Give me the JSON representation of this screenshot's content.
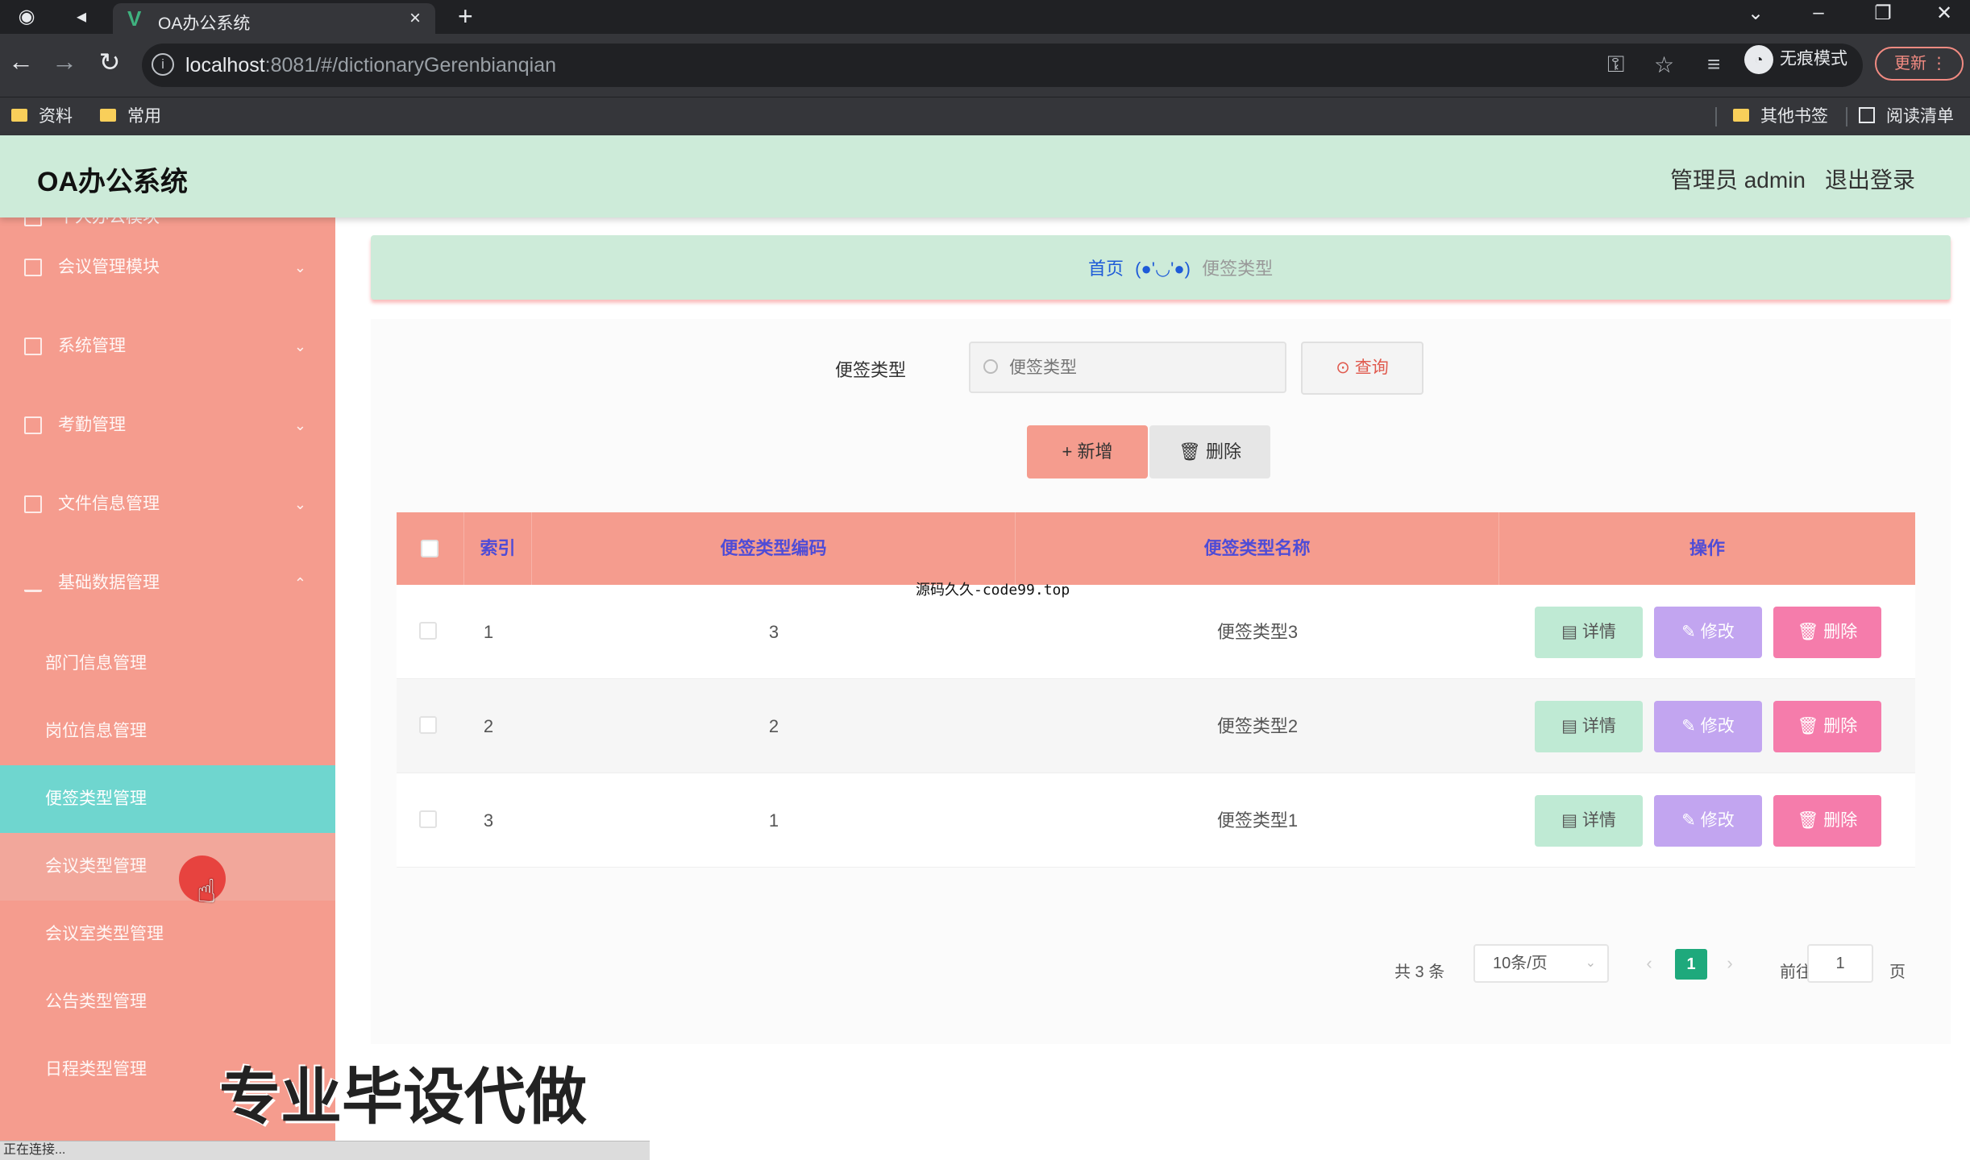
{
  "browser": {
    "tab_title": "OA办公系统",
    "tab_close": "×",
    "new_tab": "+",
    "url_host": "localhost",
    "url_rest": ":8081/#/dictionaryGerenbianqian",
    "incognito_label": "无痕模式",
    "update_label": "更新",
    "bookmarks": [
      "资料",
      "常用"
    ],
    "other_bookmarks": "其他书签",
    "reading_list": "阅读清单"
  },
  "app": {
    "title": "OA办公系统",
    "user": "管理员 admin",
    "logout": "退出登录"
  },
  "sidebar": {
    "items": [
      {
        "label": "个人办公模块"
      },
      {
        "label": "会议管理模块"
      },
      {
        "label": "系统管理"
      },
      {
        "label": "考勤管理"
      },
      {
        "label": "文件信息管理"
      },
      {
        "label": "基础数据管理"
      }
    ],
    "sub_items": [
      {
        "label": "部门信息管理"
      },
      {
        "label": "岗位信息管理"
      },
      {
        "label": "便签类型管理"
      },
      {
        "label": "会议类型管理"
      },
      {
        "label": "会议室类型管理"
      },
      {
        "label": "公告类型管理"
      },
      {
        "label": "日程类型管理"
      }
    ]
  },
  "breadcrumb": {
    "home": "首页",
    "face": "(●'◡'●)",
    "current": "便签类型"
  },
  "search": {
    "label": "便签类型",
    "placeholder": "便签类型",
    "button": "查询"
  },
  "actions": {
    "add": "+ 新增",
    "delete": "删除"
  },
  "table": {
    "headers": [
      "索引",
      "便签类型编码",
      "便签类型名称",
      "操作"
    ],
    "rows": [
      {
        "index": "1",
        "code": "3",
        "name": "便签类型3"
      },
      {
        "index": "2",
        "code": "2",
        "name": "便签类型2"
      },
      {
        "index": "3",
        "code": "1",
        "name": "便签类型1"
      }
    ],
    "op_detail": "详情",
    "op_edit": "修改",
    "op_delete": "删除"
  },
  "pagination": {
    "total": "共 3 条",
    "page_size": "10条/页",
    "current_page": "1",
    "goto_label": "前往",
    "goto_value": "1",
    "page_suffix": "页"
  },
  "overlays": {
    "watermark_line": "源码久久-code99.top",
    "promo_text": "专业毕设代做",
    "status": "正在连接..."
  },
  "colors": {
    "header_bg": "#cdebd9",
    "sidebar_bg": "#f59c8e",
    "active_item": "#6fd6cf",
    "header_text": "#4f4cd6",
    "pager_active": "#1ea97c"
  }
}
